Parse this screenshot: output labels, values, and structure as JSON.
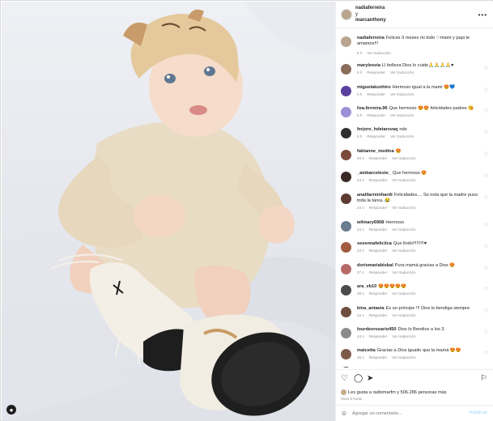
{
  "header": {
    "username": "nadiaferreira",
    "conjunction": "y",
    "coauthor": "marcanthony",
    "more_icon": "ellipsis-icon"
  },
  "caption": {
    "username": "nadiaferreira",
    "text": "Felices 9 meses mi todo ♡mami y papi te amamos!!!",
    "time": "5 h",
    "translate": "Ver traducción"
  },
  "comments": [
    {
      "username": "marylesvia",
      "text": "Ll belleza Dios lo cuide🙏🙏🙏🙏♥",
      "time": "5 h",
      "reply": "Responder",
      "translate": "Ver traducción",
      "color": "#8a6d5c"
    },
    {
      "username": "miguelakunhiro",
      "text": "Hermoso igual a la mami 😍💙",
      "time": "5 h",
      "reply": "Responder",
      "translate": "Ver traducción",
      "color": "#5b3fa0"
    },
    {
      "username": "liza.ferreira.96",
      "text": "Que hermoso 😍😍 felicidades padres 😘",
      "time": "5 h",
      "reply": "Responder",
      "translate": "Ver traducción",
      "color": "#9b8fd6"
    },
    {
      "username": "ferjoro_hdetarzvaq",
      "text": "nde",
      "time": "5 h",
      "reply": "Responder",
      "translate": "Ver traducción",
      "color": "#2f2f2f"
    },
    {
      "username": "fabianne_medina",
      "text": "😍",
      "time": "24 s",
      "reply": "Responder",
      "translate": "Ver traducción",
      "color": "#7a4b3b"
    },
    {
      "username": "_ambarceleste_",
      "text": "Que hermoso 😍",
      "time": "24 s",
      "reply": "Responder",
      "translate": "Ver traducción",
      "color": "#3b2a26"
    },
    {
      "username": "analilarreinhardt",
      "text": "Felicidades.... Se nota que la madre puso toda la tarea..😂",
      "time": "24 s",
      "reply": "Responder",
      "translate": "Ver traducción",
      "color": "#5d3b32"
    },
    {
      "username": "wilmary6908",
      "text": "Hermoso",
      "time": "24 s",
      "reply": "Responder",
      "translate": "Ver traducción",
      "color": "#6b7c8f"
    },
    {
      "username": "sesennafeliciica",
      "text": "Que lindo!!!!!!!!!♥",
      "time": "24 s",
      "reply": "Responder",
      "translate": "Ver traducción",
      "color": "#a35b3f"
    },
    {
      "username": "dorismariabisbal",
      "text": "Pura mamá gracias a Dios 😍",
      "time": "27 s",
      "reply": "Responder",
      "translate": "Ver traducción",
      "color": "#b86a6a"
    },
    {
      "username": "ara_vb10",
      "text": "😍😍😍😍😍",
      "time": "29 s",
      "reply": "Responder",
      "translate": "Ver traducción",
      "color": "#4b4b4b"
    },
    {
      "username": "kina_antavia",
      "text": "Es un príncipe !!! Dios lo bendiga siempre",
      "time": "42 s",
      "reply": "Responder",
      "translate": "Ver traducción",
      "color": "#6e4f3e"
    },
    {
      "username": "lourdesrosario450",
      "text": "Dios lo Bendice a los 3.",
      "time": "44 s",
      "reply": "Responder",
      "translate": "Ver traducción",
      "color": "#8a8a8a"
    },
    {
      "username": "maicetta",
      "text": "Gracias a Dios iguaito que la mamá 😍😍",
      "time": "46 s",
      "reply": "Responder",
      "translate": "Ver traducción",
      "color": "#7d5a49"
    },
    {
      "username": "",
      "text": "",
      "time": "",
      "reply": "",
      "translate": "",
      "color": "#5e4c44"
    }
  ],
  "actions": {
    "like_icon": "heart-icon",
    "comment_icon": "comment-icon",
    "share_icon": "send-icon",
    "save_icon": "bookmark-icon",
    "likes_text": "Les gusta a radiomarfm y 506.286 personas más",
    "date": "Hace 5 horas"
  },
  "composer": {
    "placeholder": "Agregar un comentario...",
    "publish": "Publicar",
    "emoji_icon": "smiley-icon"
  }
}
